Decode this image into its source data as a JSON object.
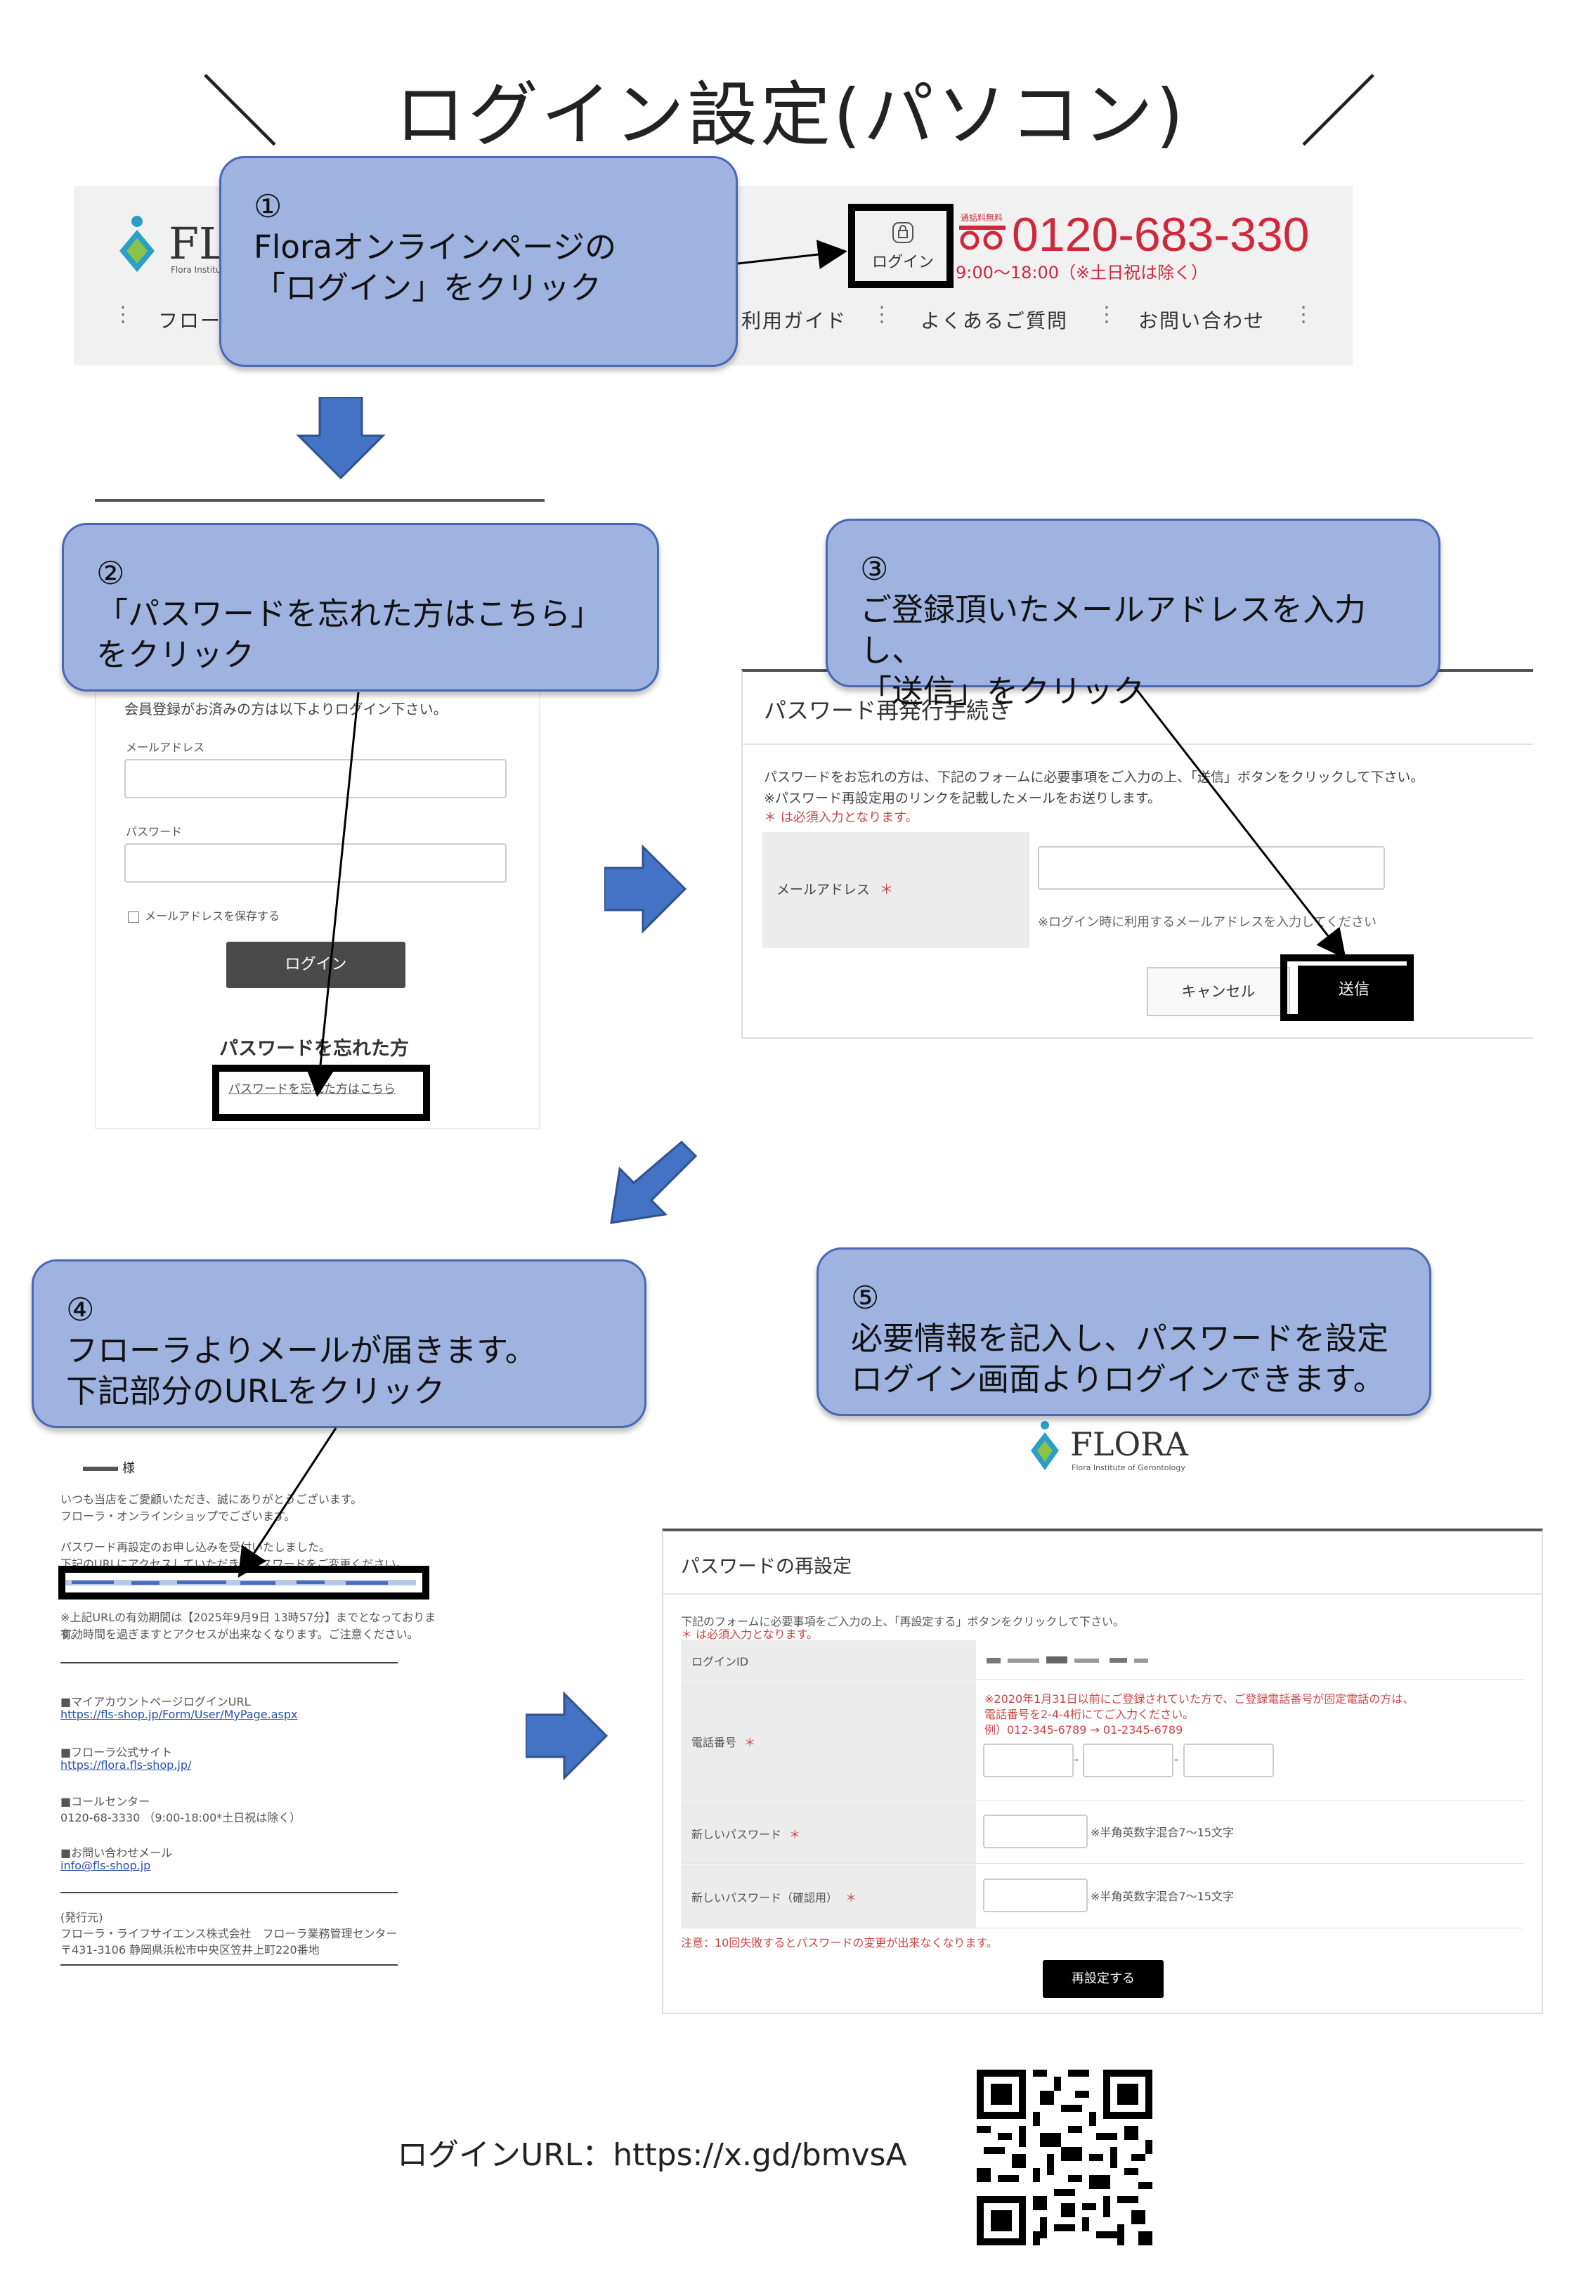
{
  "title": {
    "left_slash": "＼",
    "text": "ログイン設定(パソコン)",
    "right_slash": "／"
  },
  "step1": {
    "number": "①",
    "line1": "Floraオンラインページの",
    "line2": "「ログイン」をクリック"
  },
  "header": {
    "logo_text": "FLO",
    "logo_sub": "Flora Institute",
    "login_label": "ログイン",
    "freedial_label": "通話料無料",
    "phone": "0120-683-330",
    "hours": "9:00〜18:00（※土日祝は除く）",
    "nav": [
      "フロー",
      "利用ガイド",
      "よくあるご質問",
      "お問い合わせ"
    ]
  },
  "step2": {
    "number": "②",
    "line1": "「パスワードを忘れた方はこちら」",
    "line2": "をクリック"
  },
  "login_form": {
    "intro": "会員登録がお済みの方は以下よりログイン下さい。",
    "email_label": "メールアドレス",
    "password_label": "パスワード",
    "remember_label": "メールアドレスを保存する",
    "login_button": "ログイン",
    "forgot_heading": "パスワードを忘れた方",
    "forgot_link": "パスワードを忘れた方はこちら"
  },
  "step3": {
    "number": "③",
    "line1": "ご登録頂いたメールアドレスを入力し、",
    "line2": "「送信」をクリック"
  },
  "reset_form": {
    "heading": "パスワード再発行手続き",
    "desc1": "パスワードをお忘れの方は、下記のフォームに必要事項をご入力の上、「送信」ボタンをクリックして下さい。",
    "desc2": "※パスワード再設定用のリンクを記載したメールをお送りします。",
    "required_note": "＊ は必須入力となります。",
    "email_label": "メールアドレス",
    "required_mark": "＊",
    "email_hint": "※ログイン時に利用するメールアドレスを入力してください",
    "cancel_button": "キャンセル",
    "submit_button": "送信"
  },
  "step4": {
    "number": "④",
    "line1": "フローラよりメールが届きます。",
    "line2": "下記部分のURLをクリック"
  },
  "email": {
    "salutation": "様",
    "greeting1": "いつも当店をご愛顧いただき、誠にありがとうございます。",
    "greeting2": "フローラ・オンラインショップでございます。",
    "body1": "パスワード再設定のお申し込みを受付いたしました。",
    "body2": "下記のURLにアクセスしていただき、パスワードをご変更ください。",
    "expiry1": "※上記URLの有効期間は【2025年9月9日 13時57分】までとなっております。",
    "expiry2": "有効時間を過ぎますとアクセスが出来なくなります。ご注意ください。",
    "mypage_label": "■マイアカウントページログインURL",
    "mypage_url": "https://fls-shop.jp/Form/User/MyPage.aspx",
    "official_label": "■フローラ公式サイト",
    "official_url": "https://flora.fls-shop.jp/",
    "call_label": "■コールセンター",
    "call_value": "0120-68-3330 （9:00-18:00*土日祝は除く）",
    "mail_label": "■お問い合わせメール",
    "mail_value": "info@fls-shop.jp",
    "publisher_label": "(発行元)",
    "publisher1": "フローラ・ライフサイエンス株式会社　フローラ業務管理センター",
    "publisher2": "〒431-3106 静岡県浜松市中央区笠井上町220番地"
  },
  "step5": {
    "number": "⑤",
    "line1": "必要情報を記入し、パスワードを設定",
    "line2": "ログイン画面よりログインできます。"
  },
  "flora_logo": {
    "name": "FLORA",
    "sub": "Flora Institute of Gerontology"
  },
  "reset_password": {
    "heading": "パスワードの再設定",
    "desc": "下記のフォームに必要事項をご入力の上、「再設定する」ボタンをクリックして下さい。",
    "required_note": "＊ は必須入力となります。",
    "login_id_label": "ログインID",
    "phone_label": "電話番号",
    "phone_note1": "※2020年1月31日以前にご登録されていた方で、ご登録電話番号が固定電話の方は、",
    "phone_note2": "電話番号を2-4-4桁にてご入力ください。",
    "phone_note3": "例）012-345-6789 → 01-2345-6789",
    "new_pw_label": "新しいパスワード",
    "new_pw_hint": "※半角英数字混合7〜15文字",
    "confirm_pw_label": "新しいパスワード（確認用）",
    "confirm_pw_hint": "※半角英数字混合7〜15文字",
    "warning": "注意：10回失敗するとパスワードの変更が出来なくなります。",
    "submit_button": "再設定する"
  },
  "footer": {
    "login_url_label": "ログインURL：https://x.gd/bmvsA"
  },
  "colors": {
    "callout_fill": "#9fb3e0",
    "callout_border": "#4a67b6",
    "arrow_blue": "#4472c4",
    "phone_red": "#d0283a"
  }
}
